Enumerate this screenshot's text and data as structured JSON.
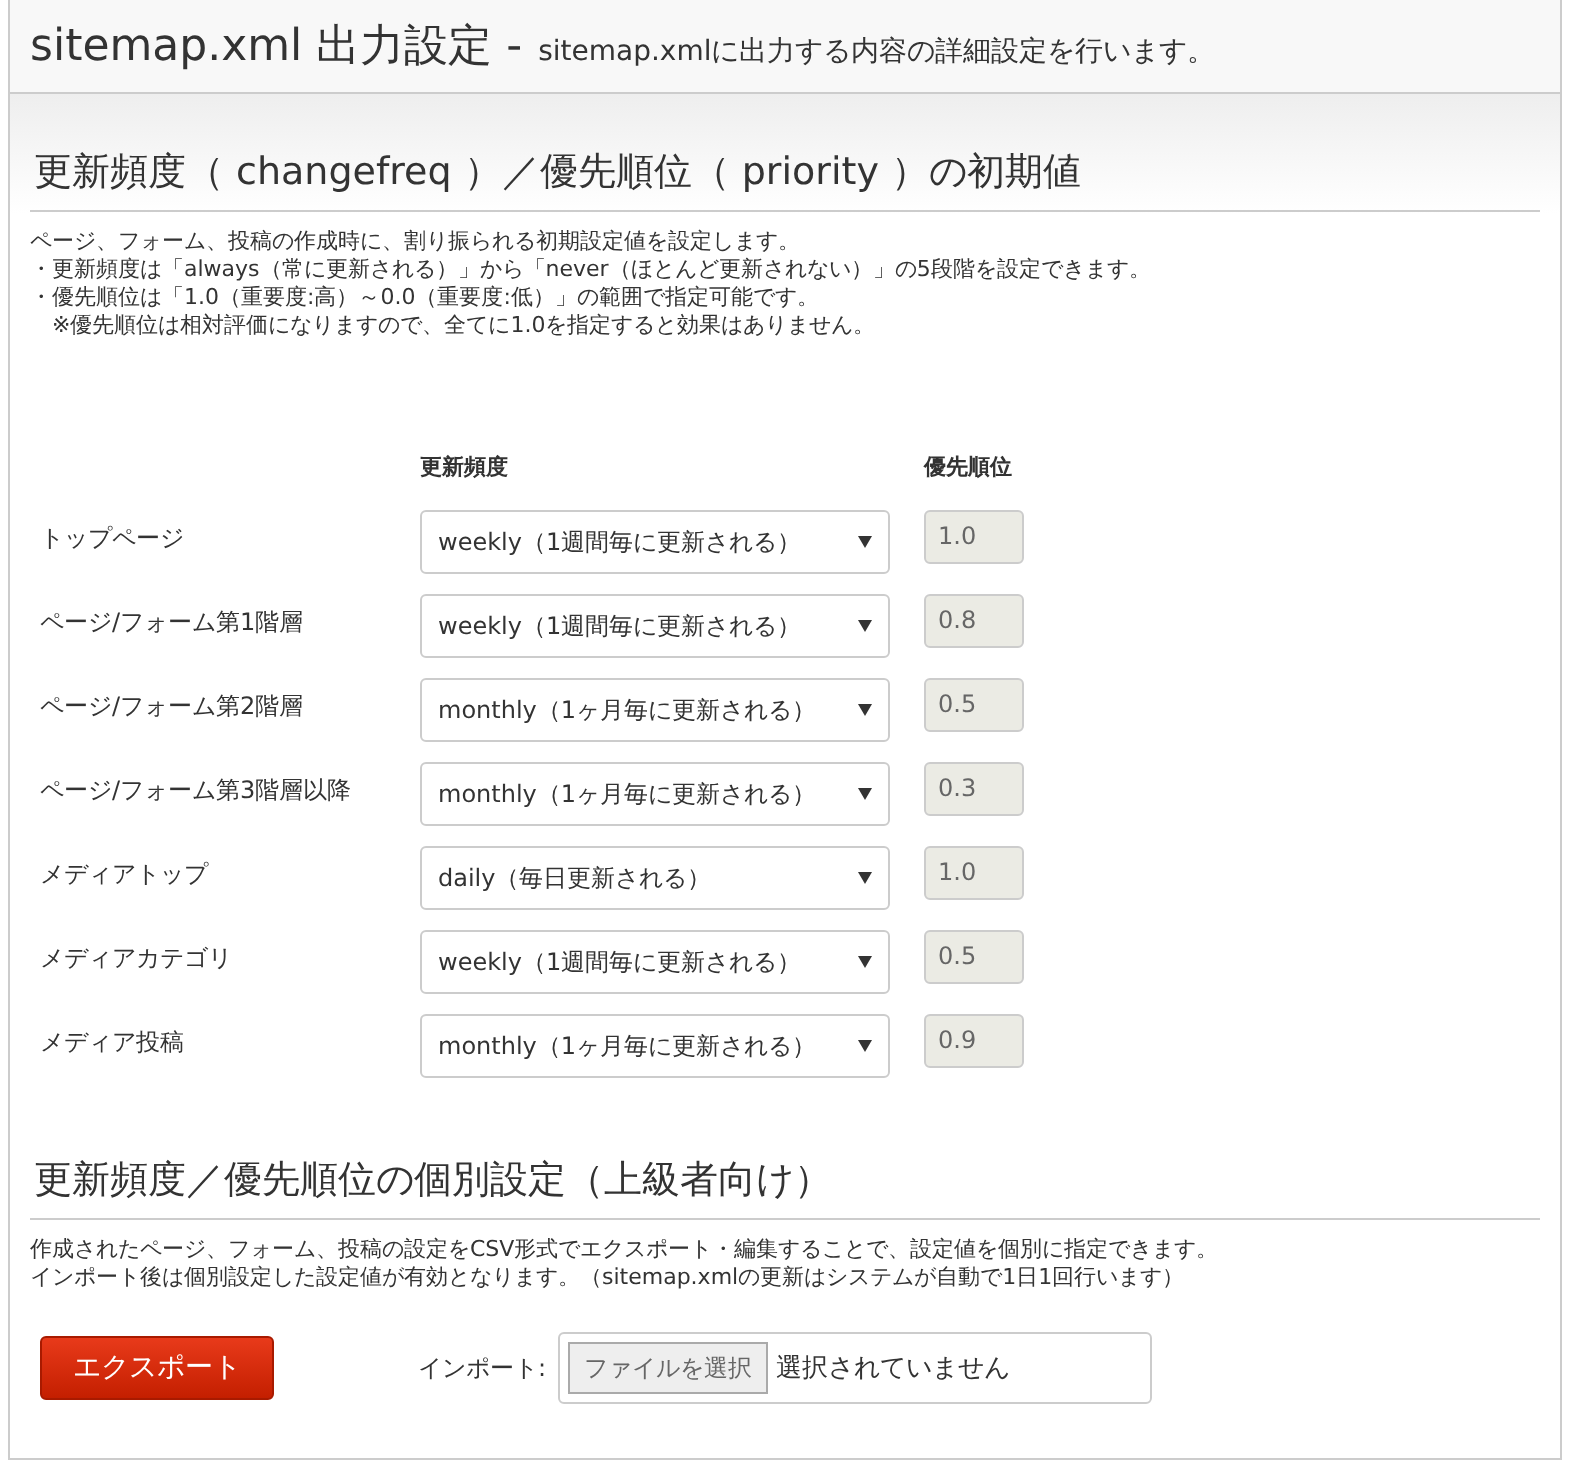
{
  "header": {
    "title": "sitemap.xml 出力設定 -",
    "subtitle": "sitemap.xmlに出力する内容の詳細設定を行います。"
  },
  "defaults": {
    "heading": "更新頻度（ changefreq ）／優先順位（ priority ）の初期値",
    "description": [
      "ページ、フォーム、投稿の作成時に、割り振られる初期設定値を設定します。",
      "・更新頻度は「always（常に更新される）」から「never（ほとんど更新されない）」の5段階を設定できます。",
      "・優先順位は「1.0（重要度:高）～0.0（重要度:低）」の範囲で指定可能です。",
      "　※優先順位は相対評価になりますので、全てに1.0を指定すると効果はありません。"
    ],
    "columns": [
      "更新頻度",
      "優先順位"
    ],
    "rows": [
      {
        "label": "トップページ",
        "changefreq": "weekly（1週間毎に更新される）",
        "priority": "1.0"
      },
      {
        "label": "ページ/フォーム第1階層",
        "changefreq": "weekly（1週間毎に更新される）",
        "priority": "0.8"
      },
      {
        "label": "ページ/フォーム第2階層",
        "changefreq": "monthly（1ヶ月毎に更新される）",
        "priority": "0.5"
      },
      {
        "label": "ページ/フォーム第3階層以降",
        "changefreq": "monthly（1ヶ月毎に更新される）",
        "priority": "0.3"
      },
      {
        "label": "メディアトップ",
        "changefreq": "daily（毎日更新される）",
        "priority": "1.0"
      },
      {
        "label": "メディアカテゴリ",
        "changefreq": "weekly（1週間毎に更新される）",
        "priority": "0.5"
      },
      {
        "label": "メディア投稿",
        "changefreq": "monthly（1ヶ月毎に更新される）",
        "priority": "0.9"
      }
    ]
  },
  "individual": {
    "heading": "更新頻度／優先順位の個別設定（上級者向け）",
    "description": [
      "作成されたページ、フォーム、投稿の設定をCSV形式でエクスポート・編集することで、設定値を個別に指定できます。",
      "インポート後は個別設定した設定値が有効となります。（sitemap.xmlの更新はシステムが自動で1日1回行います）"
    ],
    "export_button": "エクスポート",
    "import_label": "インポート:",
    "file_button": "ファイルを選択",
    "file_status": "選択されていません"
  }
}
